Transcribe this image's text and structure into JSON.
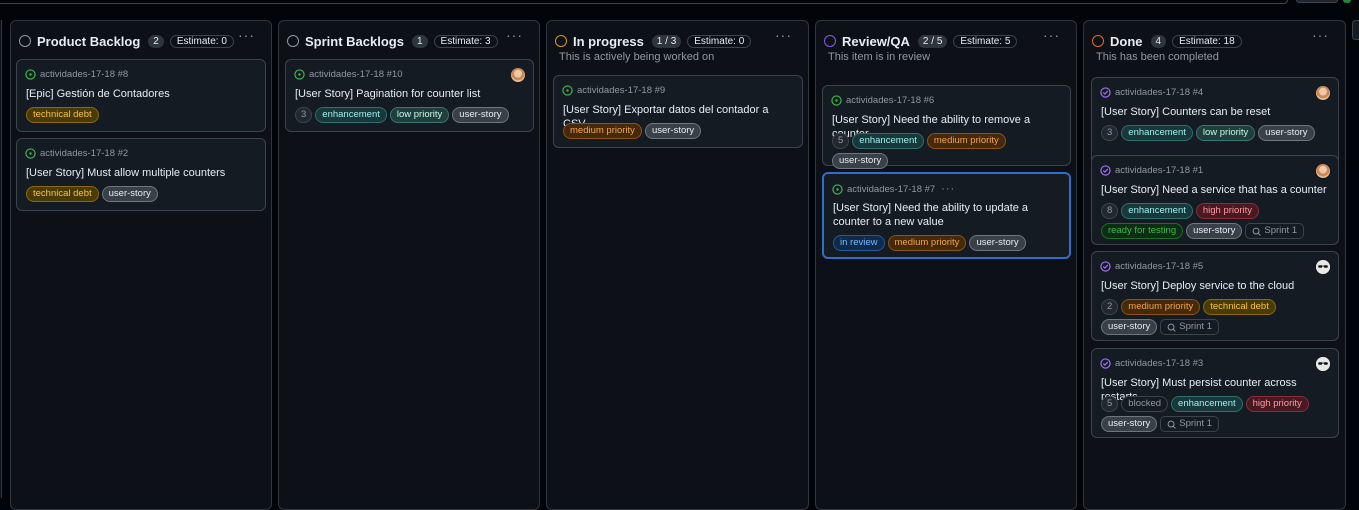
{
  "columns": [
    {
      "title": "Product Backlog",
      "count": "2",
      "estimate": "Estimate: 0",
      "description": "",
      "status_color": "#9198a1",
      "cards": [
        {
          "ref": "actividades-17-18 #8",
          "title": "[Epic] Gestión de Contadores",
          "labels": [
            "technical debt"
          ]
        },
        {
          "ref": "actividades-17-18 #2",
          "title": "[User Story] Must allow multiple counters",
          "labels": [
            "technical debt",
            "user-story"
          ]
        }
      ]
    },
    {
      "title": "Sprint Backlogs",
      "count": "1",
      "estimate": "Estimate: 3",
      "description": "",
      "status_color": "#9198a1",
      "cards": [
        {
          "ref": "actividades-17-18 #10",
          "title": "[User Story] Pagination for counter list",
          "estimate": "3",
          "labels": [
            "enhancement",
            "low priority",
            "user-story"
          ]
        }
      ]
    },
    {
      "title": "In progress",
      "count": "1 / 3",
      "estimate": "Estimate: 0",
      "description": "This is actively being worked on",
      "status_color": "#d29922",
      "cards": [
        {
          "ref": "actividades-17-18 #9",
          "title": "[User Story] Exportar datos del contador a CSV",
          "labels": [
            "medium priority",
            "user-story"
          ]
        }
      ]
    },
    {
      "title": "Review/QA",
      "count": "2 / 5",
      "estimate": "Estimate: 5",
      "description": "This item is in review",
      "status_color": "#8957e5",
      "cards": [
        {
          "ref": "actividades-17-18 #6",
          "title": "[User Story] Need the ability to remove a counter",
          "estimate": "5",
          "labels": [
            "enhancement",
            "medium priority",
            "user-story"
          ]
        },
        {
          "ref": "actividades-17-18 #7",
          "title": "[User Story] Need the ability to update a counter to a new value",
          "labels": [
            "in review",
            "medium priority",
            "user-story"
          ]
        }
      ]
    },
    {
      "title": "Done",
      "count": "4",
      "estimate": "Estimate: 18",
      "description": "This has been completed",
      "status_color": "#db6d28",
      "cards": [
        {
          "ref": "actividades-17-18 #4",
          "title": "[User Story] Counters can be reset",
          "estimate": "3",
          "labels": [
            "enhancement",
            "low priority",
            "user-story"
          ]
        },
        {
          "ref": "actividades-17-18 #1",
          "title": "[User Story] Need a service that has a counter",
          "estimate": "8",
          "labels": [
            "enhancement",
            "high priority",
            "ready for testing",
            "user-story"
          ],
          "sprint": "Sprint 1"
        },
        {
          "ref": "actividades-17-18 #5",
          "title": "[User Story] Deploy service to the cloud",
          "estimate": "2",
          "labels": [
            "medium priority",
            "technical debt",
            "user-story"
          ],
          "sprint": "Sprint 1"
        },
        {
          "ref": "actividades-17-18 #3",
          "title": "[User Story] Must persist counter across restarts",
          "estimate": "5",
          "labels": [
            "blocked",
            "enhancement",
            "high priority",
            "user-story"
          ],
          "sprint": "Sprint 1"
        }
      ]
    }
  ],
  "ui": {
    "kebab": "···"
  },
  "colors": {
    "open_issue": "#3fb950",
    "closed_issue": "#a371f7",
    "selected_border": "#316dca"
  }
}
